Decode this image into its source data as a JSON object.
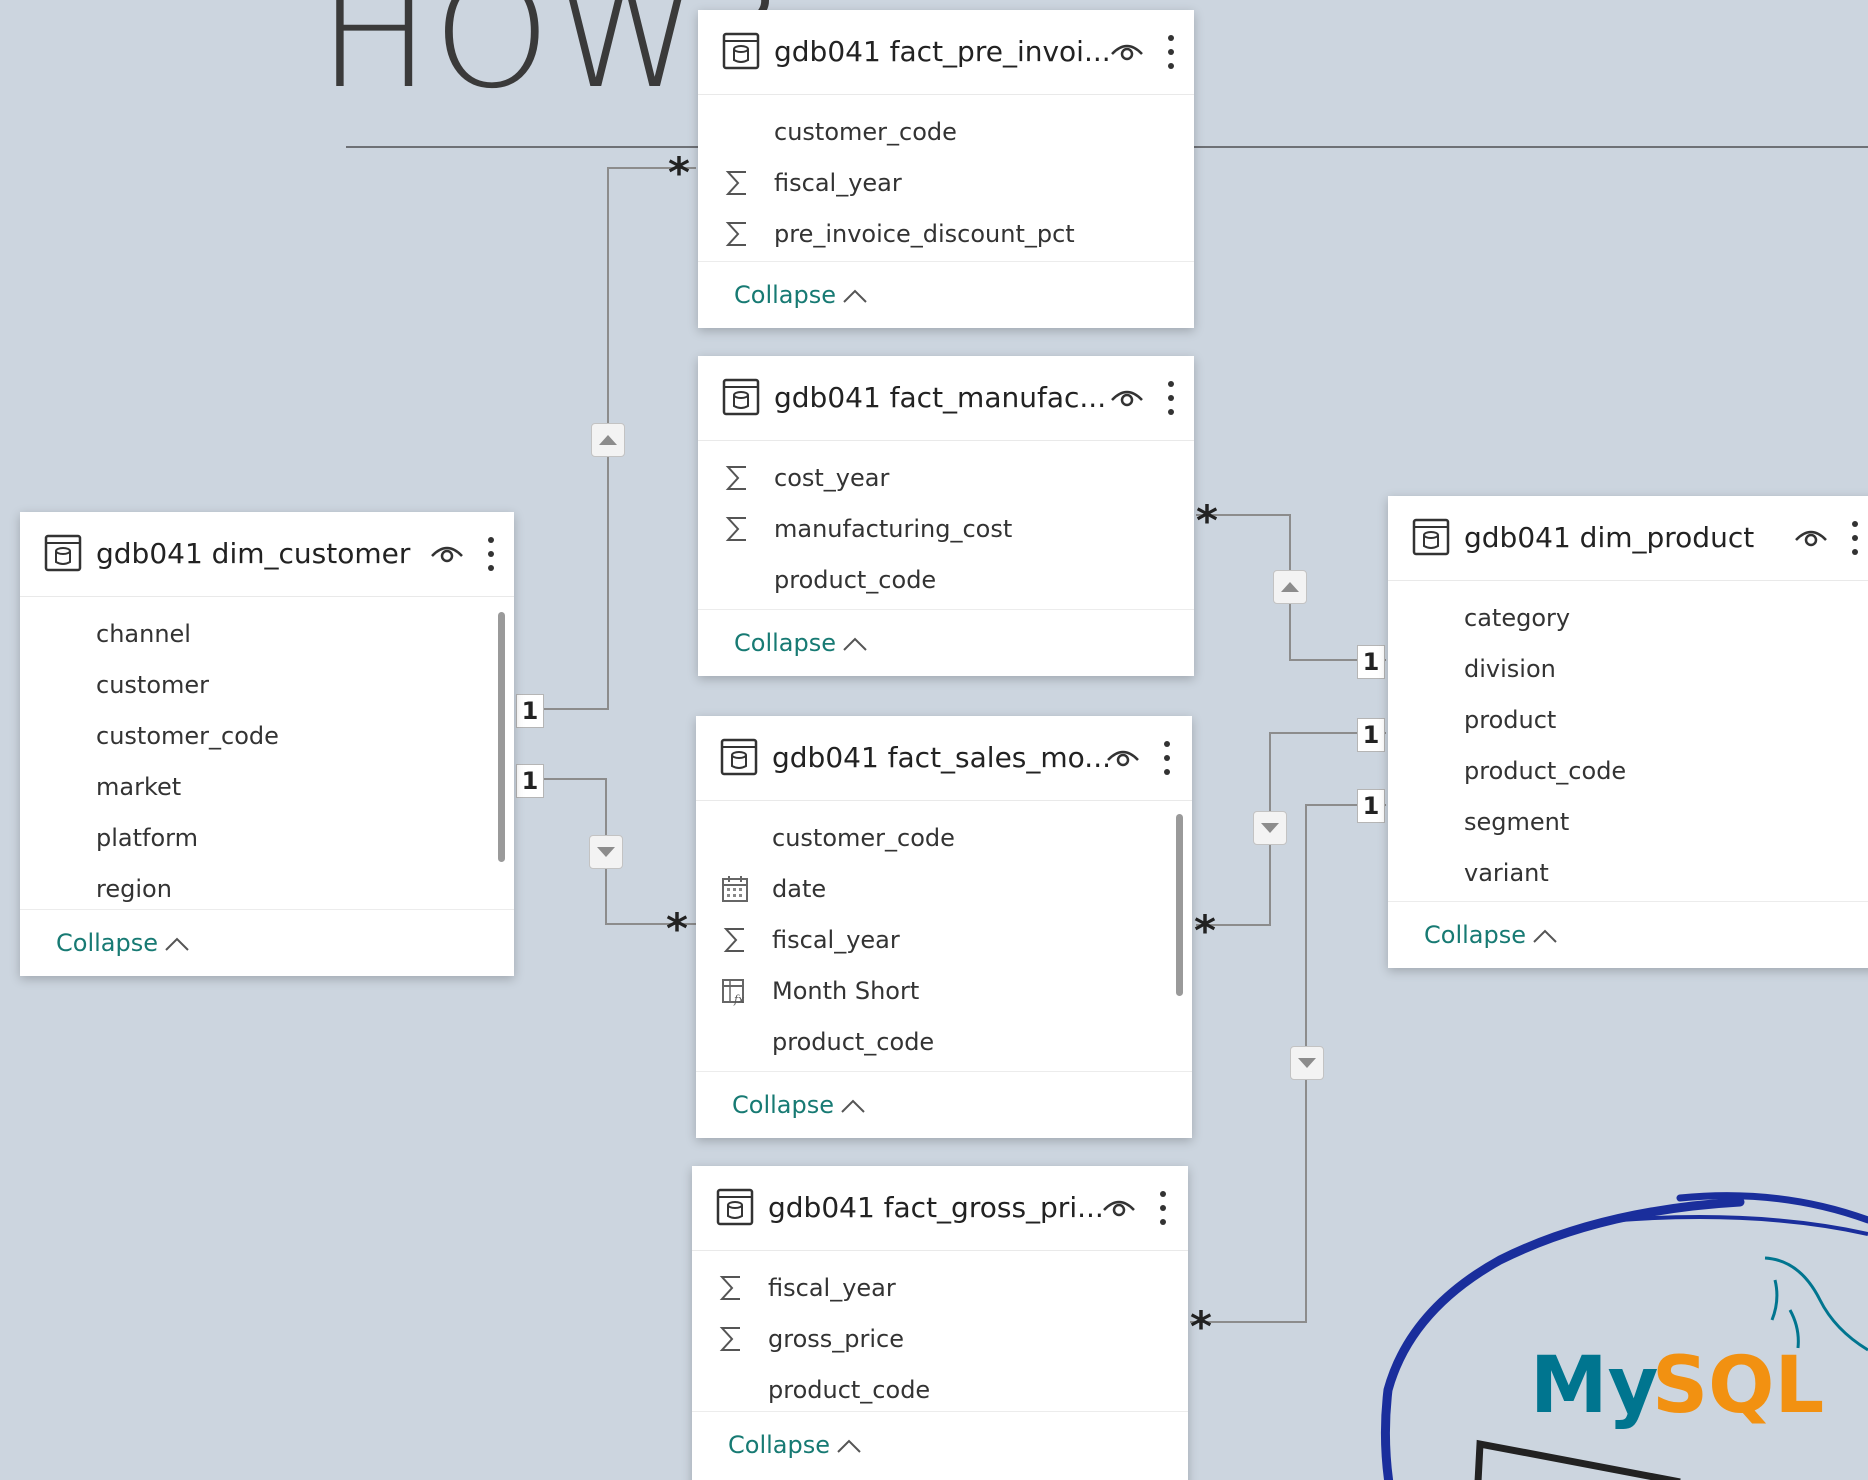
{
  "heading": "HOW?",
  "collapse_label": "Collapse",
  "cardinality": {
    "one": "1",
    "many": "*"
  },
  "logo": {
    "text_my": "My",
    "text_sql": "SQL",
    "brand_blue": "#00758f",
    "brand_orange": "#f29111",
    "ring_color": "#1a2e9c"
  },
  "colors": {
    "background": "#ccd5df",
    "link": "#177a73",
    "line": "#8c8c8c"
  },
  "tables": {
    "pre_invoice": {
      "title": "gdb041 fact_pre_invoi...",
      "fields": [
        {
          "name": "customer_code",
          "icon": "none"
        },
        {
          "name": "fiscal_year",
          "icon": "sigma-icon"
        },
        {
          "name": "pre_invoice_discount_pct",
          "icon": "sigma-icon"
        }
      ]
    },
    "manufacturing": {
      "title": "gdb041 fact_manufac...",
      "fields": [
        {
          "name": "cost_year",
          "icon": "sigma-icon"
        },
        {
          "name": "manufacturing_cost",
          "icon": "sigma-icon"
        },
        {
          "name": "product_code",
          "icon": "none"
        }
      ]
    },
    "sales": {
      "title": "gdb041 fact_sales_mo...",
      "fields": [
        {
          "name": "customer_code",
          "icon": "none"
        },
        {
          "name": "date",
          "icon": "calendar-icon"
        },
        {
          "name": "fiscal_year",
          "icon": "sigma-icon"
        },
        {
          "name": "Month Short",
          "icon": "calculated-column-icon"
        },
        {
          "name": "product_code",
          "icon": "none"
        }
      ]
    },
    "gross_price": {
      "title": "gdb041 fact_gross_pri...",
      "fields": [
        {
          "name": "fiscal_year",
          "icon": "sigma-icon"
        },
        {
          "name": "gross_price",
          "icon": "sigma-icon"
        },
        {
          "name": "product_code",
          "icon": "none"
        }
      ]
    },
    "customer": {
      "title": "gdb041 dim_customer",
      "fields": [
        {
          "name": "channel",
          "icon": "none"
        },
        {
          "name": "customer",
          "icon": "none"
        },
        {
          "name": "customer_code",
          "icon": "none"
        },
        {
          "name": "market",
          "icon": "none"
        },
        {
          "name": "platform",
          "icon": "none"
        },
        {
          "name": "region",
          "icon": "none"
        }
      ]
    },
    "product": {
      "title": "gdb041 dim_product",
      "fields": [
        {
          "name": "category",
          "icon": "none"
        },
        {
          "name": "division",
          "icon": "none"
        },
        {
          "name": "product",
          "icon": "none"
        },
        {
          "name": "product_code",
          "icon": "none"
        },
        {
          "name": "segment",
          "icon": "none"
        },
        {
          "name": "variant",
          "icon": "none"
        }
      ]
    }
  }
}
